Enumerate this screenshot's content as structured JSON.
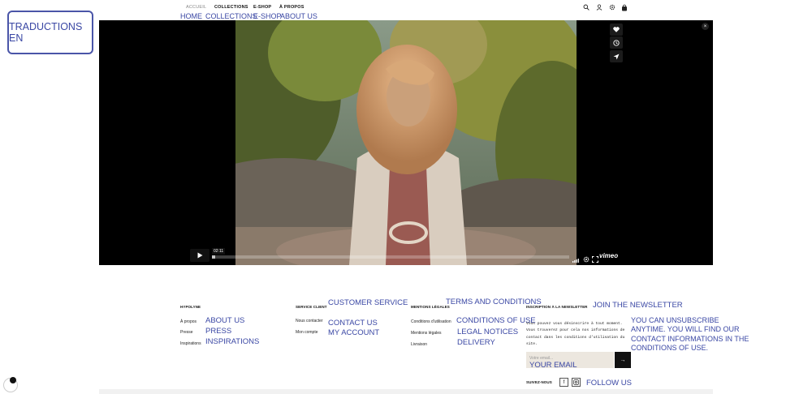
{
  "translation_badge": "TRADUCTIONS EN",
  "nav": {
    "fr": [
      "ACCUEIL",
      "COLLECTIONS",
      "E-SHOP",
      "À PROPOS"
    ],
    "en": [
      "HOME",
      "COLLECTIONS",
      "E-SHOP",
      "ABOUT US"
    ]
  },
  "header_icons": [
    "search-icon",
    "account-icon",
    "settings-icon",
    "bag-icon"
  ],
  "video": {
    "timecode": "02:11",
    "progress": 0.01,
    "brand": "vimeo",
    "side_buttons": [
      "like-icon",
      "watch-later-icon",
      "share-icon"
    ]
  },
  "footer": {
    "col1": {
      "heading": "HYPOLYNE",
      "items": [
        "À propos",
        "Presse",
        "Inspirations"
      ],
      "items_en": [
        "ABOUT US",
        "PRESS",
        "INSPIRATIONS"
      ]
    },
    "col2": {
      "heading": "SERVICE CLIENT",
      "heading_en": "CUSTOMER SERVICE",
      "items": [
        "Nous contacter",
        "Mon compte"
      ],
      "items_en": [
        "CONTACT US",
        "MY ACCOUNT"
      ]
    },
    "col3": {
      "heading": "MENTIONS LÉGALES",
      "heading_en": "TERMS AND CONDITIONS",
      "items": [
        "Conditions d'utilisation",
        "Mentions légales",
        "Livraison"
      ],
      "items_en": [
        "CONDITIONS OF USE",
        "LEGAL NOTICES",
        "DELIVERY"
      ]
    },
    "newsletter": {
      "heading": "INSCRIPTION À LA NEWSLETTER",
      "heading_en": "JOIN THE NEWSLETTER",
      "text": "Vous pouvez vous désinscrire à tout moment. Vous trouverez pour cela nos informations de contact dans les conditions d'utilisation du site.",
      "text_en": "YOU CAN UNSUBSCRIBE ANYTIME. YOU WILL FIND OUR CONTACT INFORMATIONS IN THE CONDITIONS OF USE.",
      "email_placeholder": "Votre email...",
      "email_en": "YOUR EMAIL",
      "submit": "→"
    },
    "follow": {
      "label": "SUIVEZ-NOUS",
      "label_en": "FOLLOW US",
      "icons": [
        "facebook-icon",
        "instagram-icon"
      ]
    }
  }
}
